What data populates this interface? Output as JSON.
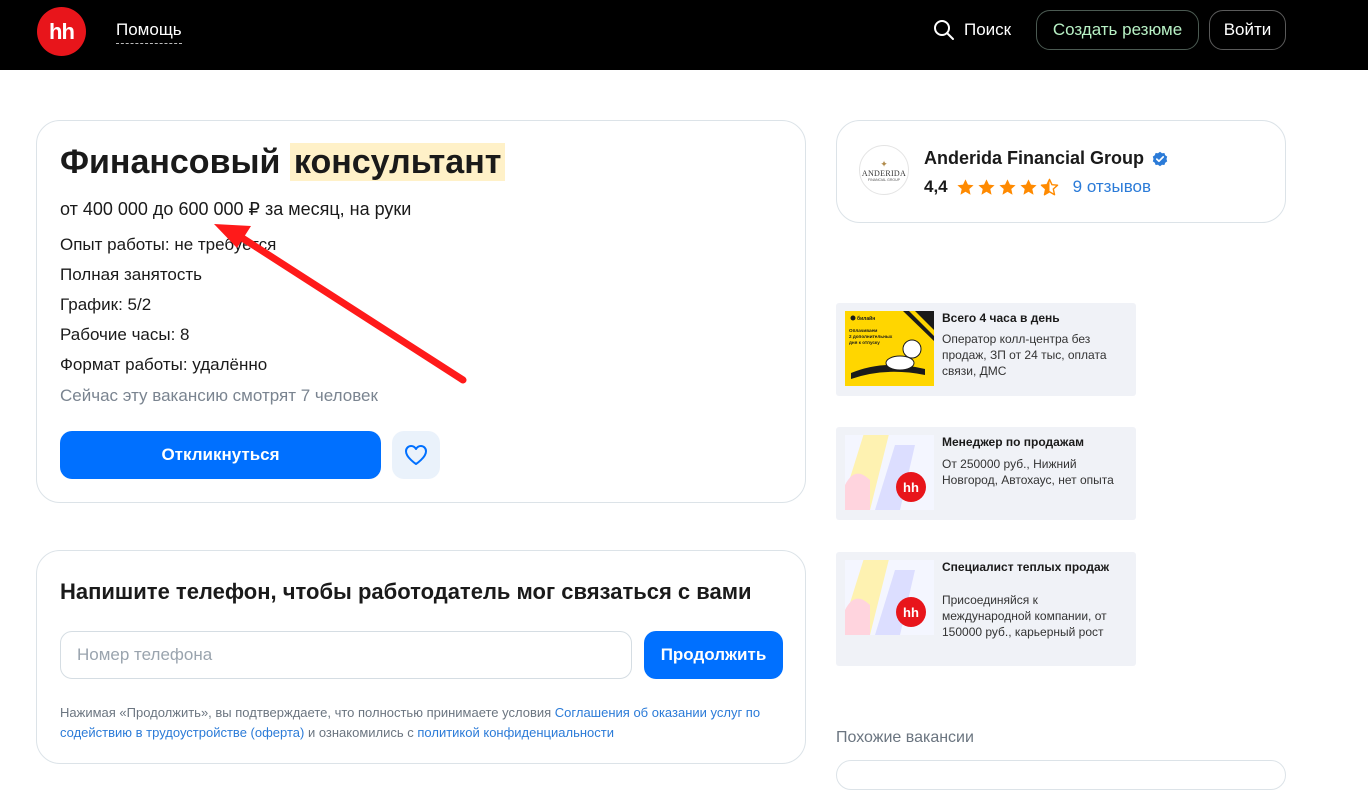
{
  "header": {
    "logo_text": "hh",
    "help_label": "Помощь",
    "search_label": "Поиск",
    "create_resume_label": "Создать резюме",
    "login_label": "Войти"
  },
  "vacancy": {
    "title_part1": "Финансовый",
    "title_part2": "консультант",
    "salary": "от 400 000 до 600 000 ₽ за месяц, на руки",
    "experience": "Опыт работы: не требуется",
    "employment": "Полная занятость",
    "schedule": "График: 5/2",
    "hours": "Рабочие часы: 8",
    "format": "Формат работы: удалённо",
    "viewers": "Сейчас эту вакансию смотрят 7 человек",
    "apply_label": "Откликнуться"
  },
  "phone_form": {
    "title": "Напишите телефон, чтобы работодатель мог связаться с вами",
    "placeholder": "Номер телефона",
    "value": "",
    "continue_label": "Продолжить",
    "legal_prefix": "Нажимая «Продолжить», вы подтверждаете, что полностью принимаете условия ",
    "legal_link1": "Соглашения об оказании услуг по содействию в трудоустройстве (оферта)",
    "legal_middle": " и ознакомились с ",
    "legal_link2": "политикой конфиденциальности"
  },
  "company": {
    "name": "Anderida Financial Group",
    "logo_name": "ANDERIDA",
    "logo_sub": "FINANCIAL GROUP",
    "rating": "4,4",
    "stars_value": 4.4,
    "reviews": "9 отзывов"
  },
  "ads": [
    {
      "title": "Всего 4 часа в день",
      "text": "Оператор колл-центра без продаж, ЗП от 24 тыс, оплата связи, ДМС",
      "image_brand": "билайн",
      "image_text": "Оплачиваем 2 дополнительных дня к отпуску"
    },
    {
      "title": "Менеджер по продажам",
      "text": "От 250000 руб., Нижний Новгород, Автохаус, нет опыта",
      "image_brand": "hh"
    },
    {
      "title": "Специалист теплых продаж",
      "text": "Присоединяйся к международной компании, от 150000 руб., карьерный рост",
      "image_brand": "hh"
    }
  ],
  "similar_label": "Похожие вакансии",
  "colors": {
    "primary": "#0070ff",
    "brand_red": "#e8151b",
    "link": "#2b7bd8",
    "star": "#ff8a00",
    "annotation_arrow": "#ff1a1a"
  }
}
